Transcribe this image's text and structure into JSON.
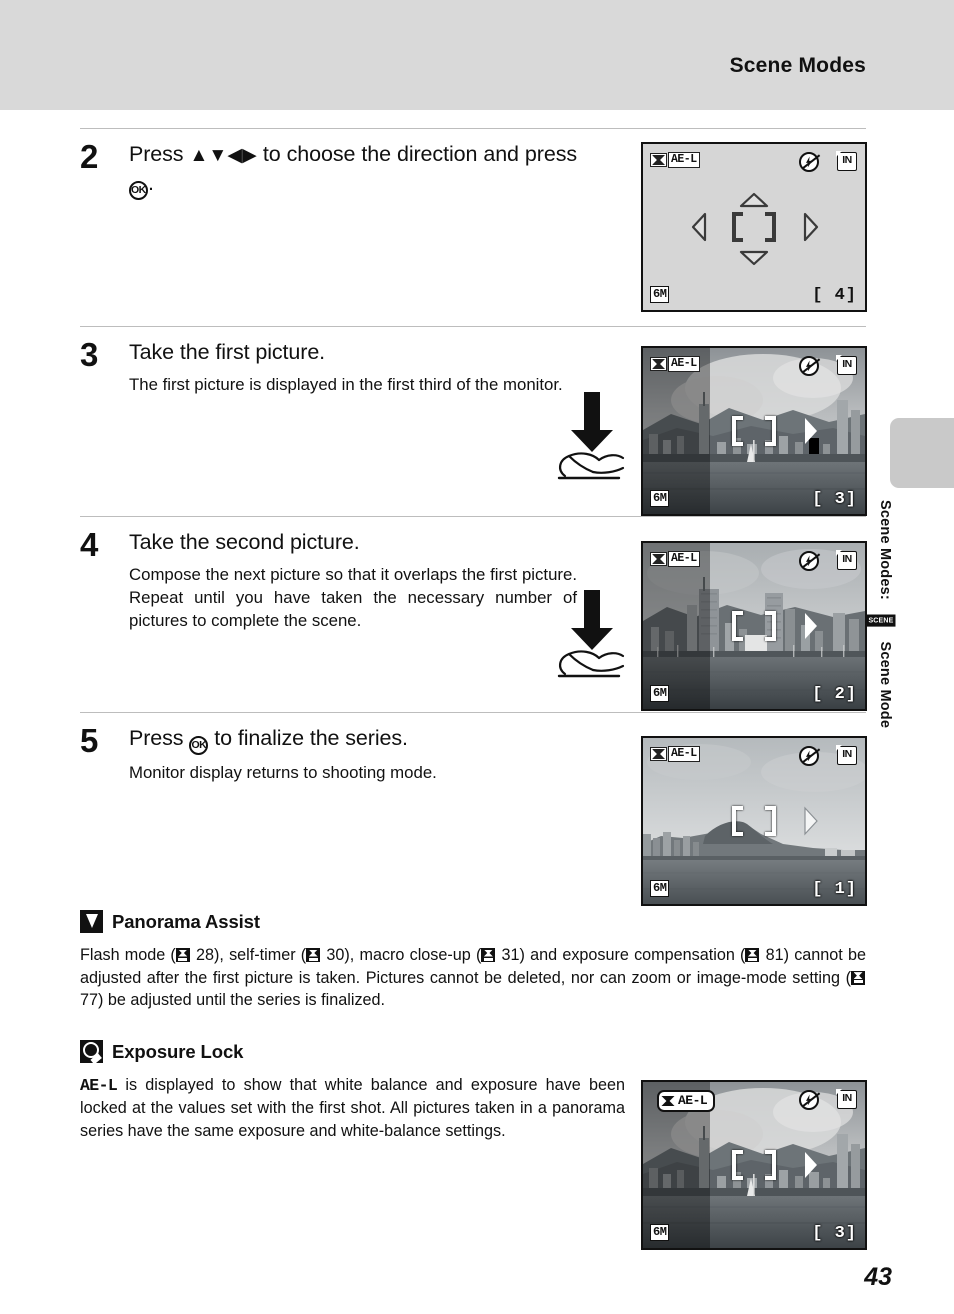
{
  "header": {
    "title": "Scene Modes"
  },
  "side_tab": {
    "text_before": "Scene Modes:",
    "icon": "scene-mode-icon",
    "icon_label": "SCENE",
    "text_after": "Scene Mode"
  },
  "steps": [
    {
      "number": "2",
      "title_before": "Press",
      "arrows": "▲▼◀▶",
      "title_mid": "to choose the direction and press",
      "ok_label": "OK",
      "title_end": ".",
      "desc": ""
    },
    {
      "number": "3",
      "title": "Take the first picture.",
      "desc": "The first picture is displayed in the first third of the monitor."
    },
    {
      "number": "4",
      "title": "Take the second picture.",
      "desc": "Compose the next picture so that it overlaps the first picture. Repeat until you have taken the necessary number of pictures to complete the scene."
    },
    {
      "number": "5",
      "title_before": "Press",
      "ok_label": "OK",
      "title_after": "to finalize the series.",
      "desc": "Monitor display returns to shooting mode."
    }
  ],
  "lcd_screens": [
    {
      "id": "direction-select",
      "ae_lock_label": "AE-L",
      "ae_lock_highlighted": false,
      "flash_icon": "flash-off-icon",
      "memory_icon": "internal-memory-icon",
      "memory_label": "IN",
      "image_size_label": "6M",
      "shots_remaining": "[    4]",
      "has_photo": false,
      "shows_direction_arrows": true
    },
    {
      "id": "first-picture",
      "ae_lock_label": "AE-L",
      "ae_lock_highlighted": false,
      "flash_icon": "flash-off-icon",
      "memory_icon": "internal-memory-icon",
      "memory_label": "IN",
      "image_size_label": "6M",
      "shots_remaining": "[    3]",
      "has_photo": true,
      "scene": "city-skyline-clouds",
      "dim_fraction": 0.3
    },
    {
      "id": "second-picture",
      "ae_lock_label": "AE-L",
      "ae_lock_highlighted": false,
      "flash_icon": "flash-off-icon",
      "memory_icon": "internal-memory-icon",
      "memory_label": "IN",
      "image_size_label": "6M",
      "shots_remaining": "[    2]",
      "has_photo": true,
      "scene": "city-highrise-harbor",
      "dim_fraction": 0.3
    },
    {
      "id": "series-finalized",
      "ae_lock_label": "AE-L",
      "ae_lock_highlighted": false,
      "flash_icon": "flash-off-icon",
      "memory_icon": "internal-memory-icon",
      "memory_label": "IN",
      "image_size_label": "6M",
      "shots_remaining": "[    1]",
      "has_photo": true,
      "scene": "diamond-head-coast",
      "dim_fraction": 0
    },
    {
      "id": "exposure-lock",
      "ae_lock_label": "AE-L",
      "ae_lock_highlighted": true,
      "flash_icon": "flash-off-icon",
      "memory_icon": "internal-memory-icon",
      "memory_label": "IN",
      "image_size_label": "6M",
      "shots_remaining": "[    3]",
      "has_photo": true,
      "scene": "city-skyline-clouds",
      "dim_fraction": 0.3
    }
  ],
  "notes": [
    {
      "icon": "caution-icon",
      "title": "Panorama Assist",
      "body_parts": [
        "Flash mode (",
        " 28), self-timer (",
        " 30), macro close-up (",
        " 31) and exposure compensation (",
        " 81) cannot be adjusted after the first picture is taken. Pictures cannot be deleted, nor can zoom or image-mode setting (",
        " 77) be adjusted until the series is finalized."
      ]
    },
    {
      "icon": "tip-icon",
      "title": "Exposure Lock",
      "lead_symbol": "AE-L",
      "body": " is displayed to show that white balance and exposure have been locked at the values set with the first shot. All pictures taken in a panorama series have the same exposure and white-balance settings."
    }
  ],
  "page_number": "43"
}
